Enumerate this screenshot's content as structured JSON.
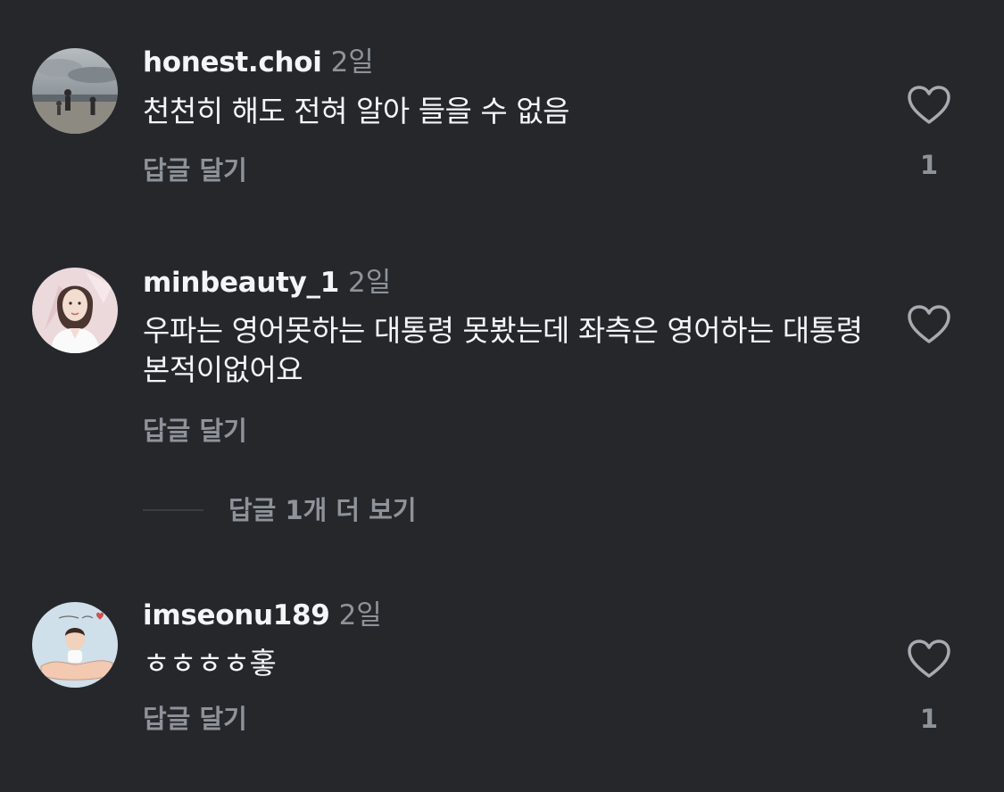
{
  "comments": [
    {
      "username": "honest.choi",
      "time": "2일",
      "text": "천천히 해도 전혀 알아 들을 수 없음",
      "reply_label": "답글 달기",
      "like_count": "1",
      "avatar_icon": "beach-photo-avatar"
    },
    {
      "username": "minbeauty_1",
      "time": "2일",
      "text": "우파는 영어못하는 대통령 못봤는데 좌측은 영어하는 대통령 본적이없어요",
      "reply_label": "답글 달기",
      "like_count": "",
      "avatar_icon": "woman-portrait-avatar"
    },
    {
      "username": "imseonu189",
      "time": "2일",
      "text": "ㅎㅎㅎㅎ홓",
      "reply_label": "답글 달기",
      "like_count": "1",
      "avatar_icon": "child-in-hand-avatar"
    }
  ],
  "view_more_replies": "답글 1개 더 보기",
  "colors": {
    "background": "#25272b",
    "primary_text": "#f3f5f7",
    "secondary_text": "#8e939a"
  }
}
